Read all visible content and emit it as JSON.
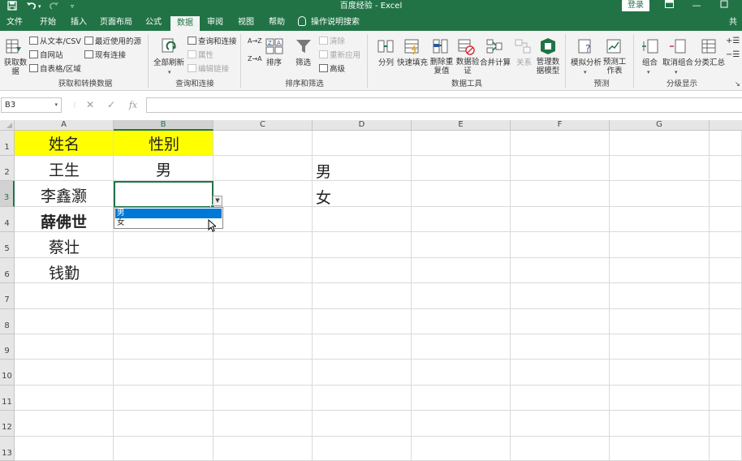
{
  "window": {
    "title": "百度经验  -  Excel",
    "login_label": "登录",
    "share_label": "共"
  },
  "quick_access": [
    "save-icon",
    "undo-icon",
    "redo-icon",
    "customize-icon"
  ],
  "tabs": [
    {
      "label": "文件",
      "active": false
    },
    {
      "label": "开始",
      "active": false
    },
    {
      "label": "插入",
      "active": false
    },
    {
      "label": "页面布局",
      "active": false
    },
    {
      "label": "公式",
      "active": false
    },
    {
      "label": "数据",
      "active": true
    },
    {
      "label": "审阅",
      "active": false
    },
    {
      "label": "视图",
      "active": false
    },
    {
      "label": "帮助",
      "active": false
    }
  ],
  "tell_me": "操作说明搜索",
  "ribbon": {
    "get_data": {
      "get_data_label": "获取数据",
      "from_text_csv": "从文本/CSV",
      "from_web": "自网站",
      "from_table": "自表格/区域",
      "recent_sources": "最近使用的源",
      "existing_connections": "现有连接",
      "group_label": "获取和转换数据"
    },
    "queries": {
      "refresh_all": "全部刷新",
      "queries_connections": "查询和连接",
      "properties": "属性",
      "edit_links": "编辑链接",
      "group_label": "查询和连接"
    },
    "sort_filter": {
      "sort_az": "A→Z",
      "sort_za": "Z→A",
      "sort": "排序",
      "filter": "筛选",
      "clear": "清除",
      "reapply": "重新应用",
      "advanced": "高级",
      "group_label": "排序和筛选"
    },
    "data_tools": {
      "text_to_columns": "分列",
      "flash_fill": "快速填充",
      "remove_duplicates": "删除重复值",
      "data_validation": "数据验证",
      "consolidate": "合并计算",
      "relationships": "关系",
      "data_model": "管理数据模型",
      "group_label": "数据工具"
    },
    "forecast": {
      "what_if": "模拟分析",
      "forecast_sheet": "预测工作表",
      "group_label": "预测"
    },
    "outline": {
      "group": "组合",
      "ungroup": "取消组合",
      "subtotal": "分类汇总",
      "group_label": "分级显示"
    }
  },
  "formula_bar": {
    "name_box": "B3",
    "cancel": "✕",
    "enter": "✓",
    "fx": "fx",
    "content": ""
  },
  "sheet": {
    "columns": [
      "A",
      "B",
      "C",
      "D",
      "E",
      "F",
      "G"
    ],
    "rows": [
      "1",
      "2",
      "3",
      "4",
      "5",
      "6",
      "7",
      "8",
      "9",
      "10",
      "11",
      "12",
      "13"
    ],
    "header_fill": "#ffff00",
    "cells": {
      "A1": "姓名",
      "B1": "性别",
      "A2": "王生",
      "B2": "男",
      "A3": "李鑫灏",
      "A4": "薛佛世",
      "A5": "蔡壮",
      "A6": "钱勤",
      "D2": "男",
      "D3": "女"
    },
    "active_cell": "B3",
    "dropdown_options": [
      {
        "label": "男",
        "highlighted": true
      },
      {
        "label": "女",
        "highlighted": false
      }
    ]
  },
  "colors": {
    "excel_green": "#217346",
    "ribbon_bg": "#f3f3f3",
    "selection_blue": "#0078d7"
  }
}
